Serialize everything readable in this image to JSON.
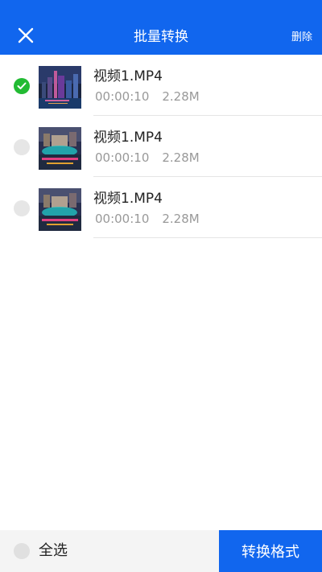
{
  "header": {
    "title": "批量转换",
    "delete_label": "删除",
    "close_icon": "close-icon",
    "background": "#1166ee"
  },
  "items": [
    {
      "name": "视频1.MP4",
      "duration": "00:00:10",
      "size": "2.28M",
      "selected": true
    },
    {
      "name": "视频1.MP4",
      "duration": "00:00:10",
      "size": "2.28M",
      "selected": false
    },
    {
      "name": "视频1.MP4",
      "duration": "00:00:10",
      "size": "2.28M",
      "selected": false
    }
  ],
  "footer": {
    "select_all_label": "全选",
    "convert_label": "转换格式"
  },
  "colors": {
    "accent": "#1166ee",
    "checked": "#22bb33",
    "unchecked": "#e6e6e6"
  }
}
